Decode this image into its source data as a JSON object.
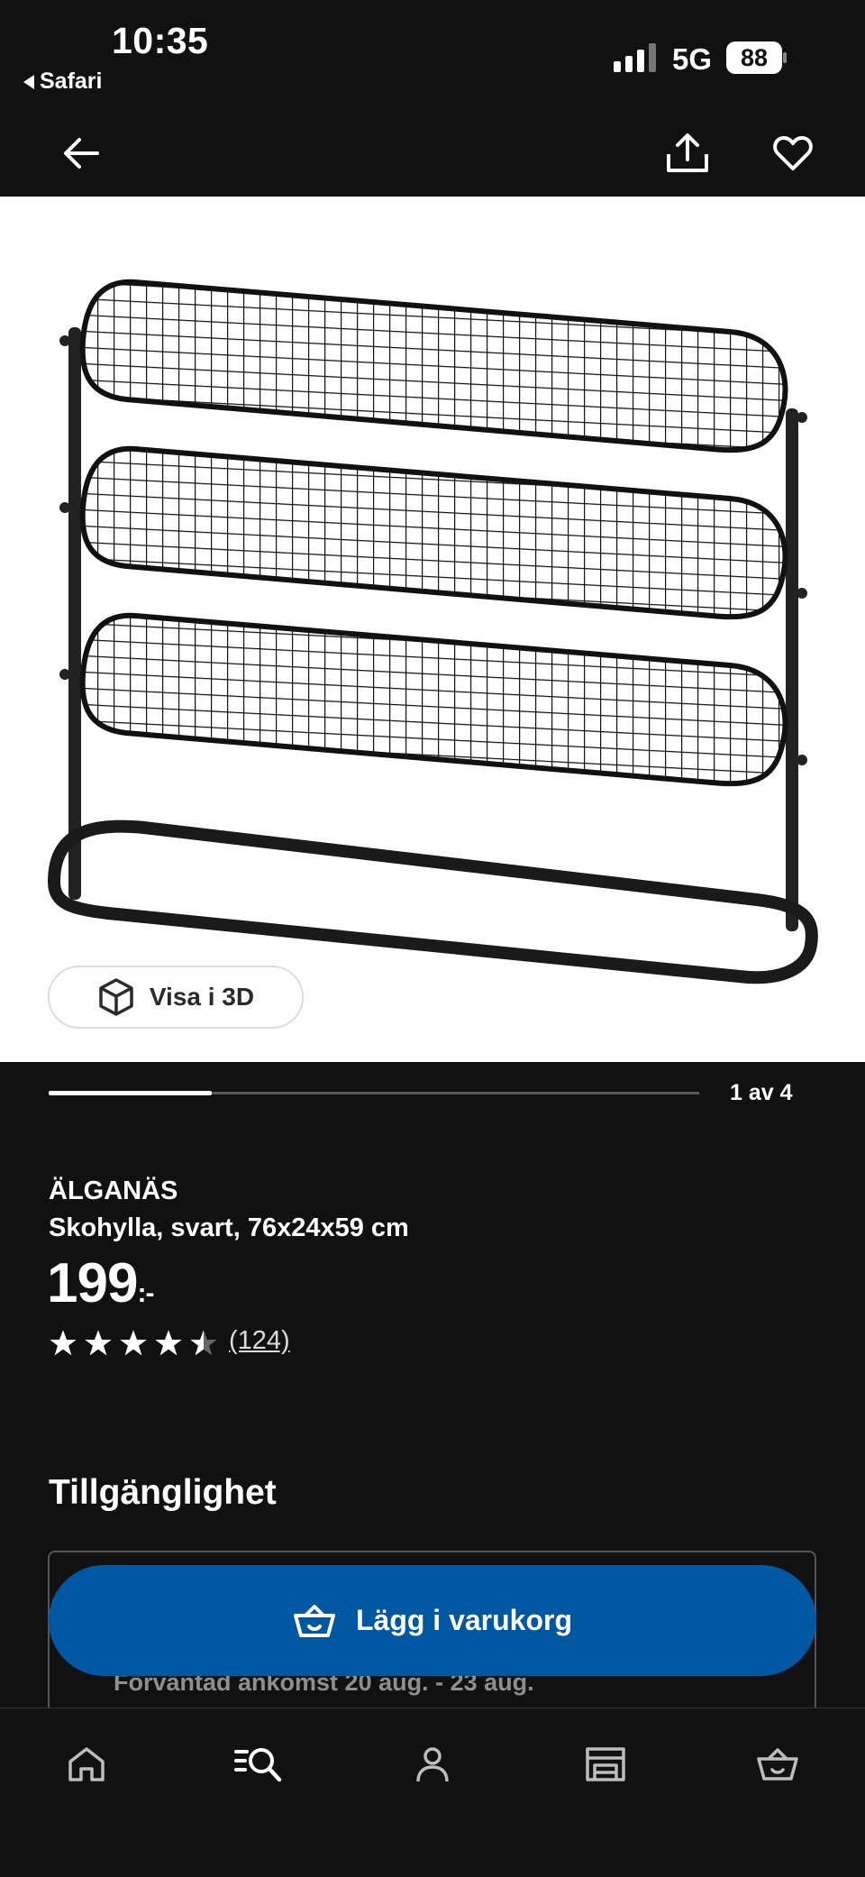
{
  "status_bar": {
    "time": "10:35",
    "back_app": "Safari",
    "network": "5G",
    "battery": "88"
  },
  "top_nav": {
    "icons": [
      "arrow-left-icon",
      "share-icon",
      "heart-icon"
    ]
  },
  "gallery": {
    "view_3d_label": "Visa i 3D",
    "page_indicator": "1 av 4",
    "progress_fraction": 0.25
  },
  "product": {
    "brand": "ÄLGANÄS",
    "description": "Skohylla, svart, 76x24x59 cm",
    "price": "199",
    "price_suffix": ":-",
    "rating": 4.5,
    "review_count": "(124)"
  },
  "availability": {
    "title": "Tillgänglighet",
    "arrival_text": "Förväntad ankomst 20 aug. - 23 aug."
  },
  "cart_button": {
    "label": "Lägg i varukorg"
  },
  "tab_bar": {
    "icons": [
      "home-icon",
      "search-list-icon",
      "profile-icon",
      "store-icon",
      "cart-icon"
    ],
    "active": "search-list-icon"
  },
  "colors": {
    "background": "#111111",
    "accent_blue": "#0058a3"
  }
}
